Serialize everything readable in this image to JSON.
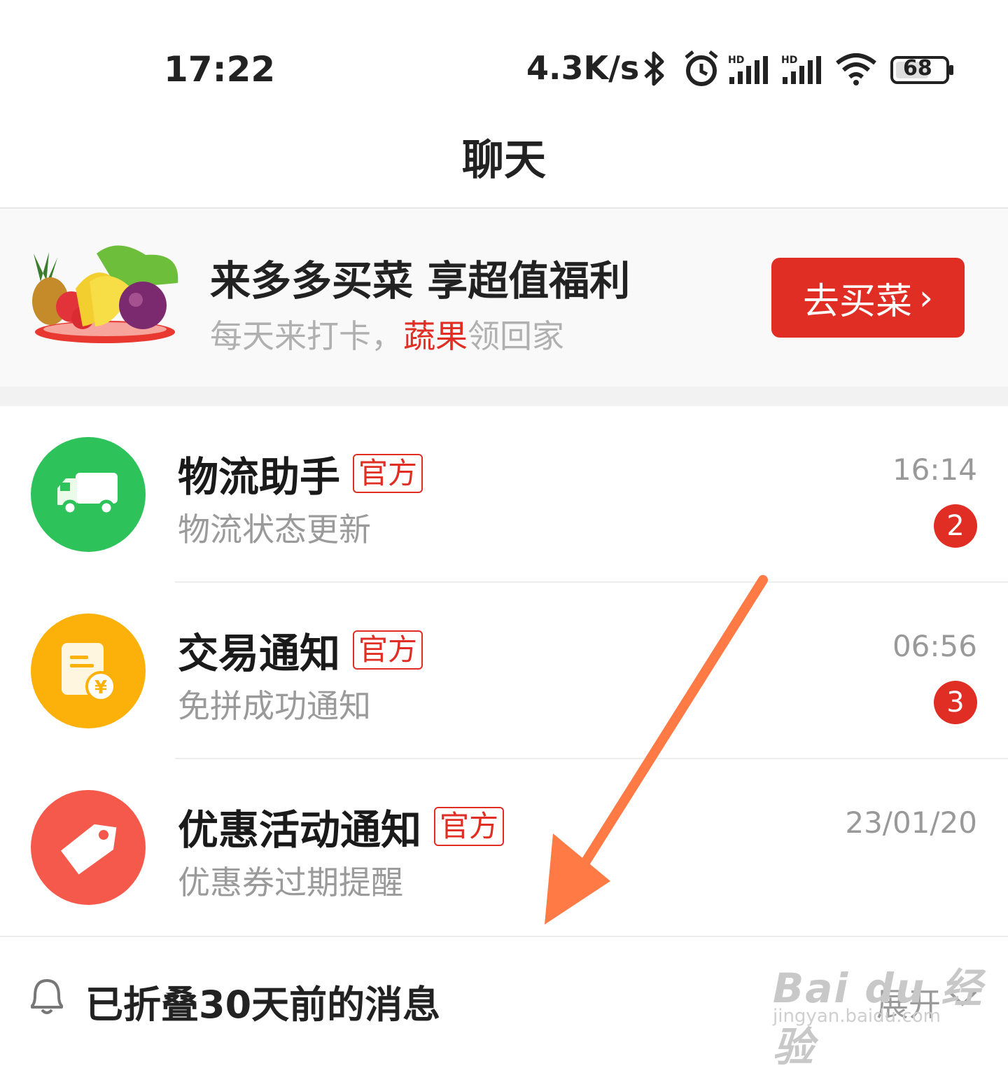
{
  "status_bar": {
    "time": "17:22",
    "network_speed": "4.3K/s",
    "battery": "68",
    "icons": [
      "bluetooth-icon",
      "alarm-icon",
      "signal-hd-icon",
      "signal-hd-icon",
      "wifi-icon",
      "battery-icon"
    ]
  },
  "header": {
    "title": "聊天"
  },
  "banner": {
    "title": "来多多买菜 享超值福利",
    "subtitle_prefix": "每天来打卡，",
    "subtitle_highlight": "蔬果",
    "subtitle_suffix": "领回家",
    "button_label": "去买菜",
    "button_chevron": "›"
  },
  "chats": [
    {
      "name": "物流助手",
      "badge": "官方",
      "preview": "物流状态更新",
      "time": "16:14",
      "unread": "2",
      "avatar_color": "#2ec25a",
      "icon": "truck-icon"
    },
    {
      "name": "交易通知",
      "badge": "官方",
      "preview": "免拼成功通知",
      "time": "06:56",
      "unread": "3",
      "avatar_color": "#fbb10a",
      "icon": "receipt-icon"
    },
    {
      "name": "优惠活动通知",
      "badge": "官方",
      "preview": "优惠券过期提醒",
      "time": "23/01/20",
      "unread": "",
      "avatar_color": "#f4594b",
      "icon": "tag-icon"
    }
  ],
  "folded": {
    "label": "已折叠30天前的消息",
    "expand_label": "展开"
  },
  "watermark": {
    "brand": "Bai du 经验",
    "url": "jingyan.baidu.com"
  },
  "colors": {
    "accent": "#e02e24",
    "arrow": "#ff7a45"
  }
}
